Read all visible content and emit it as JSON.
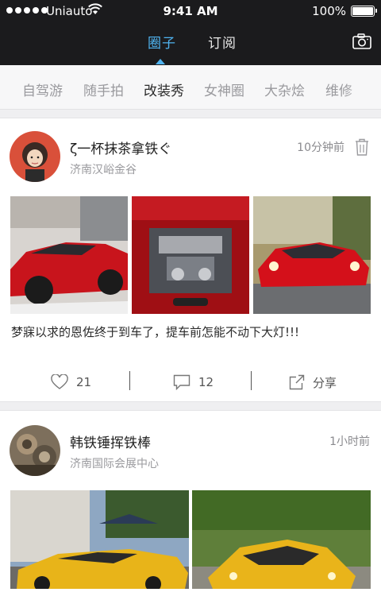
{
  "status_bar": {
    "carrier": "Uniauto",
    "time": "9:41 AM",
    "battery": "100%"
  },
  "nav": {
    "tabs": [
      {
        "label": "圈子",
        "active": true
      },
      {
        "label": "订阅",
        "active": false
      }
    ],
    "camera_icon": "camera-icon"
  },
  "categories": [
    {
      "label": "自驾游",
      "active": false
    },
    {
      "label": "随手拍",
      "active": false
    },
    {
      "label": "改装秀",
      "active": true
    },
    {
      "label": "女神圈",
      "active": false
    },
    {
      "label": "大杂烩",
      "active": false
    },
    {
      "label": "维修",
      "active": false
    }
  ],
  "posts": [
    {
      "user": "ζ一杯抹茶拿铁ぐ",
      "location": "济南汉峪金谷",
      "time": "10分钟前",
      "text": "梦寐以求的恩佐终于到车了，提车前怎能不动下大灯!!!",
      "likes": "21",
      "comments": "12",
      "share_label": "分享"
    },
    {
      "user": "韩铁锤挥铁棒",
      "location": "济南国际会展中心",
      "time": "1小时前"
    }
  ],
  "colors": {
    "accent": "#4fb3f0",
    "topbar": "#1b1b1d"
  }
}
